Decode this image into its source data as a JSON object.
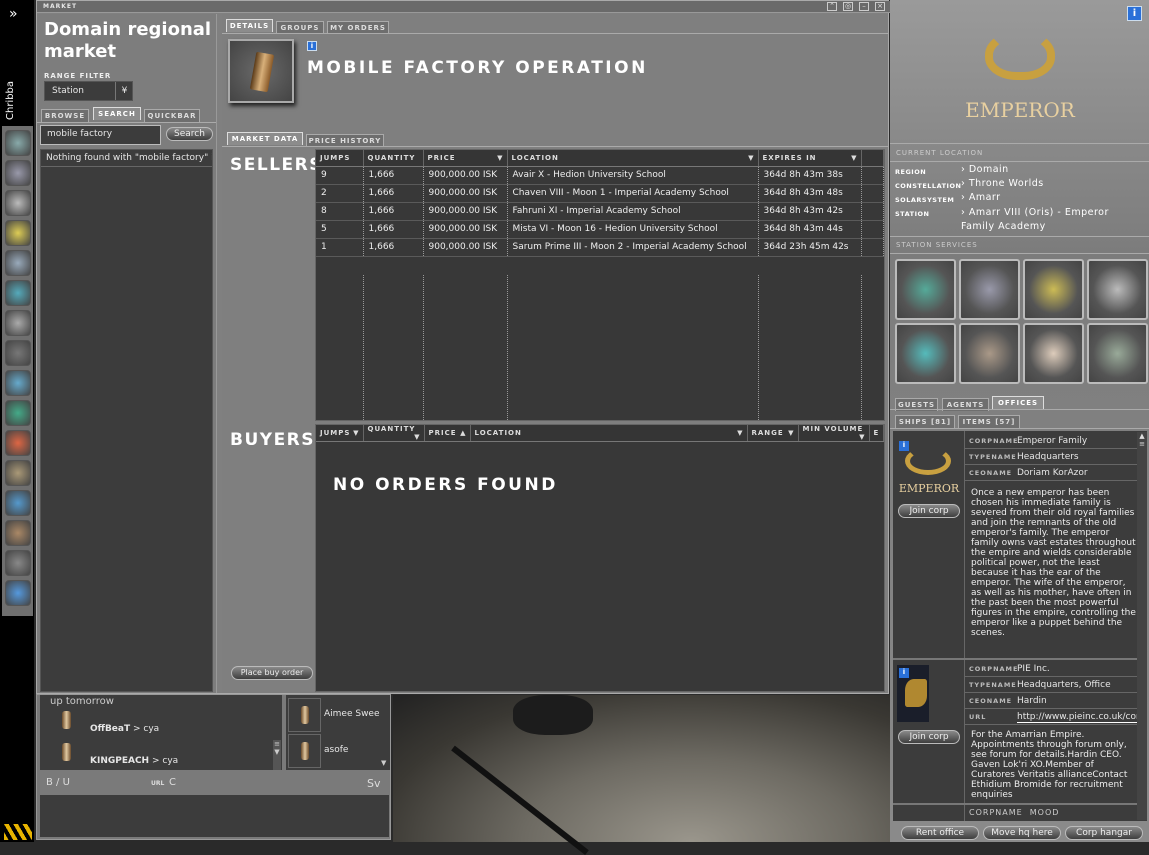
{
  "sidebar": {
    "expand_icon": "»",
    "pilot_name": "Chribba"
  },
  "market": {
    "window_title": "MARKET",
    "region_title": "Domain regional market",
    "range_filter_label": "RANGE FILTER",
    "range_filter_value": "Station",
    "left_tabs": [
      "BROWSE",
      "SEARCH",
      "QUICKBAR"
    ],
    "search_value": "mobile factory",
    "search_button": "Search",
    "search_result": "Nothing found with \"mobile factory\" in",
    "place_buy_order": "Place buy order",
    "detail_tabs": [
      "DETAILS",
      "GROUPS",
      "MY ORDERS"
    ],
    "item_title": "MOBILE FACTORY OPERATION",
    "data_tabs": [
      "MARKET DATA",
      "PRICE HISTORY"
    ],
    "sellers_label": "SELLERS",
    "buyers_label": "BUYERS",
    "sellers_columns": [
      "JUMPS",
      "QUANTITY",
      "PRICE",
      "LOCATION",
      "EXPIRES IN"
    ],
    "sellers_rows": [
      [
        "9",
        "1,666",
        "900,000.00 ISK",
        "Avair X - Hedion University School",
        "364d 8h 43m 38s"
      ],
      [
        "2",
        "1,666",
        "900,000.00 ISK",
        "Chaven VIII - Moon 1 - Imperial Academy School",
        "364d 8h 43m 48s"
      ],
      [
        "8",
        "1,666",
        "900,000.00 ISK",
        "Fahruni XI - Imperial Academy School",
        "364d 8h 43m 42s"
      ],
      [
        "5",
        "1,666",
        "900,000.00 ISK",
        "Mista VI - Moon 16 - Hedion University School",
        "364d 8h 43m 44s"
      ],
      [
        "1",
        "1,666",
        "900,000.00 ISK",
        "Sarum Prime III - Moon 2 - Imperial Academy School",
        "364d 23h 45m 42s"
      ]
    ],
    "buyers_columns": [
      "JUMPS",
      "QUANTITY",
      "PRICE",
      "LOCATION",
      "RANGE",
      "MIN VOLUME",
      "E"
    ],
    "no_orders": "NO ORDERS FOUND"
  },
  "station": {
    "logo_text": "EMPEROR",
    "current_location_label": "CURRENT LOCATION",
    "location": [
      {
        "label": "REGION",
        "value": "Domain"
      },
      {
        "label": "CONSTELLATION",
        "value": "Throne Worlds"
      },
      {
        "label": "SOLARSYSTEM",
        "value": "Amarr"
      },
      {
        "label": "STATION",
        "value": "Amarr VIII (Oris) - Emperor Family Academy"
      }
    ],
    "services_label": "STATION SERVICES",
    "services": [
      "medical",
      "repair-shop",
      "reprocessing-plant",
      "market",
      "fitting",
      "factory",
      "contracts",
      "ship-hangar"
    ],
    "tabs": [
      "GUESTS",
      "AGENTS",
      "OFFICES"
    ],
    "subtabs": [
      "SHIPS [81]",
      "ITEMS [57]"
    ],
    "offices": [
      {
        "logo": "EMPEROR",
        "join": "Join corp",
        "rows": [
          [
            "CORPNAME",
            "Emperor Family"
          ],
          [
            "TYPENAME",
            "Headquarters"
          ],
          [
            "CEONAME",
            "Doriam KorAzor"
          ]
        ],
        "description": "Once a new emperor has been chosen his immediate family is severed from their old royal families and join the remnants of the old emperor's family. The emperor family owns vast estates throughout the empire and wields considerable political power, not the least because it has the ear of the emperor. The wife of the emperor, as well as his mother, have often in the past been the most powerful figures in the empire, controlling the emperor like a puppet behind the scenes."
      },
      {
        "join": "Join corp",
        "rows": [
          [
            "CORPNAME",
            "PIE Inc."
          ],
          [
            "TYPENAME",
            "Headquarters, Office"
          ],
          [
            "CEONAME",
            "Hardin"
          ],
          [
            "URL",
            "http://www.pieinc.co.uk/cor"
          ]
        ],
        "description": "For the Amarrian Empire. Appointments through forum only, see forum for details.Hardin CEO. Gaven Lok'ri XO.Member of Curatores Veritatis allianceContact Ethidium Bromide for recruitment enquiries"
      }
    ],
    "partial_next": "CORPNAME  MOOD",
    "buttons": [
      "Rent office",
      "Move hq here",
      "Corp hangar"
    ]
  },
  "chat": {
    "cut_line": "up tomorrow",
    "messages": [
      {
        "name": "OffBeaT",
        "text": "> cya"
      },
      {
        "name": "KINGPEACH",
        "text": "> cya"
      }
    ],
    "members": [
      "Aimee Swee",
      "asofe"
    ],
    "toolbar_left": "B / U",
    "toolbar_url": "URL",
    "toolbar_c": "C",
    "toolbar_right": "Sv"
  }
}
